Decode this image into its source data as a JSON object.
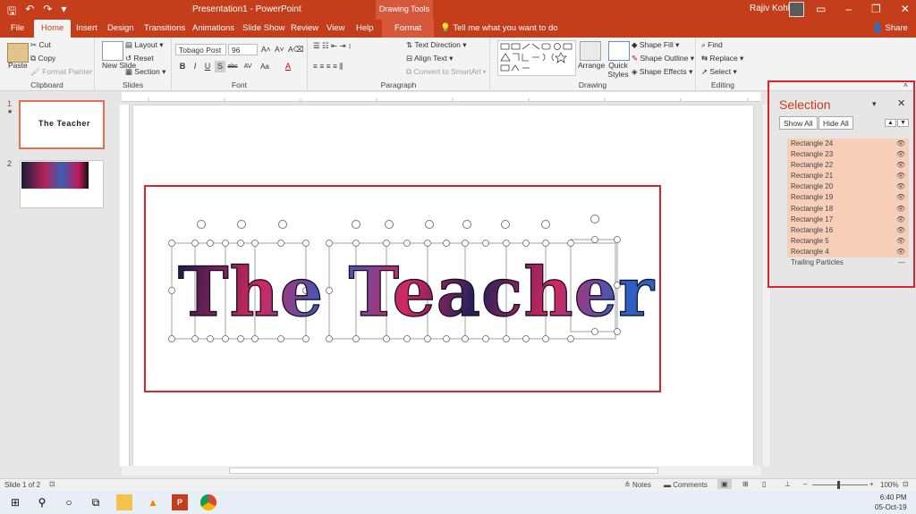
{
  "titlebar": {
    "doc_title": "Presentation1  -  PowerPoint",
    "contextual_tab": "Drawing Tools",
    "user_name": "Rajiv Kohli"
  },
  "tabs": {
    "file": "File",
    "home": "Home",
    "insert": "Insert",
    "design": "Design",
    "transitions": "Transitions",
    "animations": "Animations",
    "slide_show": "Slide Show",
    "review": "Review",
    "view": "View",
    "help": "Help",
    "format": "Format",
    "tell_me": "Tell me what you want to do",
    "share": "Share"
  },
  "ribbon": {
    "clipboard": {
      "label": "Clipboard",
      "paste": "Paste",
      "cut": "Cut",
      "copy": "Copy",
      "format_painter": "Format Painter"
    },
    "slides": {
      "label": "Slides",
      "new_slide": "New Slide",
      "layout": "Layout",
      "reset": "Reset",
      "section": "Section"
    },
    "font": {
      "label": "Font",
      "font_name": "Tobago Post",
      "font_size": "96"
    },
    "paragraph": {
      "label": "Paragraph",
      "text_direction": "Text Direction",
      "align_text": "Align Text",
      "convert_smartart": "Convert to SmartArt"
    },
    "drawing": {
      "label": "Drawing",
      "arrange": "Arrange",
      "quick_styles": "Quick Styles",
      "shape_fill": "Shape Fill",
      "shape_outline": "Shape Outline",
      "shape_effects": "Shape Effects"
    },
    "editing": {
      "label": "Editing",
      "find": "Find",
      "replace": "Replace",
      "select": "Select"
    }
  },
  "thumbnails": [
    {
      "number": "1",
      "title": "The Teacher"
    },
    {
      "number": "2"
    }
  ],
  "slide": {
    "title_text": "The Teacher"
  },
  "selection_pane": {
    "title": "Selection",
    "show_all": "Show All",
    "hide_all": "Hide All",
    "items": [
      {
        "name": "Rectangle 24",
        "highlighted": true
      },
      {
        "name": "Rectangle 23",
        "highlighted": true
      },
      {
        "name": "Rectangle 22",
        "highlighted": true
      },
      {
        "name": "Rectangle 21",
        "highlighted": true
      },
      {
        "name": "Rectangle 20",
        "highlighted": true
      },
      {
        "name": "Rectangle 19",
        "highlighted": true
      },
      {
        "name": "Rectangle 18",
        "highlighted": true
      },
      {
        "name": "Rectangle 17",
        "highlighted": true
      },
      {
        "name": "Rectangle 16",
        "highlighted": true
      },
      {
        "name": "Rectangle 5",
        "highlighted": true
      },
      {
        "name": "Rectangle 4",
        "highlighted": true
      },
      {
        "name": "Trailing Particles",
        "highlighted": false
      }
    ]
  },
  "statusbar": {
    "slide_count": "Slide 1 of 2",
    "notes": "Notes",
    "comments": "Comments",
    "zoom": "100%"
  },
  "taskbar": {
    "time": "6:40 PM",
    "date": "05-Oct-19"
  },
  "colors": {
    "accent": "#c43e1c",
    "highlight": "#f7cfb9",
    "annotation": "#d9232d"
  }
}
